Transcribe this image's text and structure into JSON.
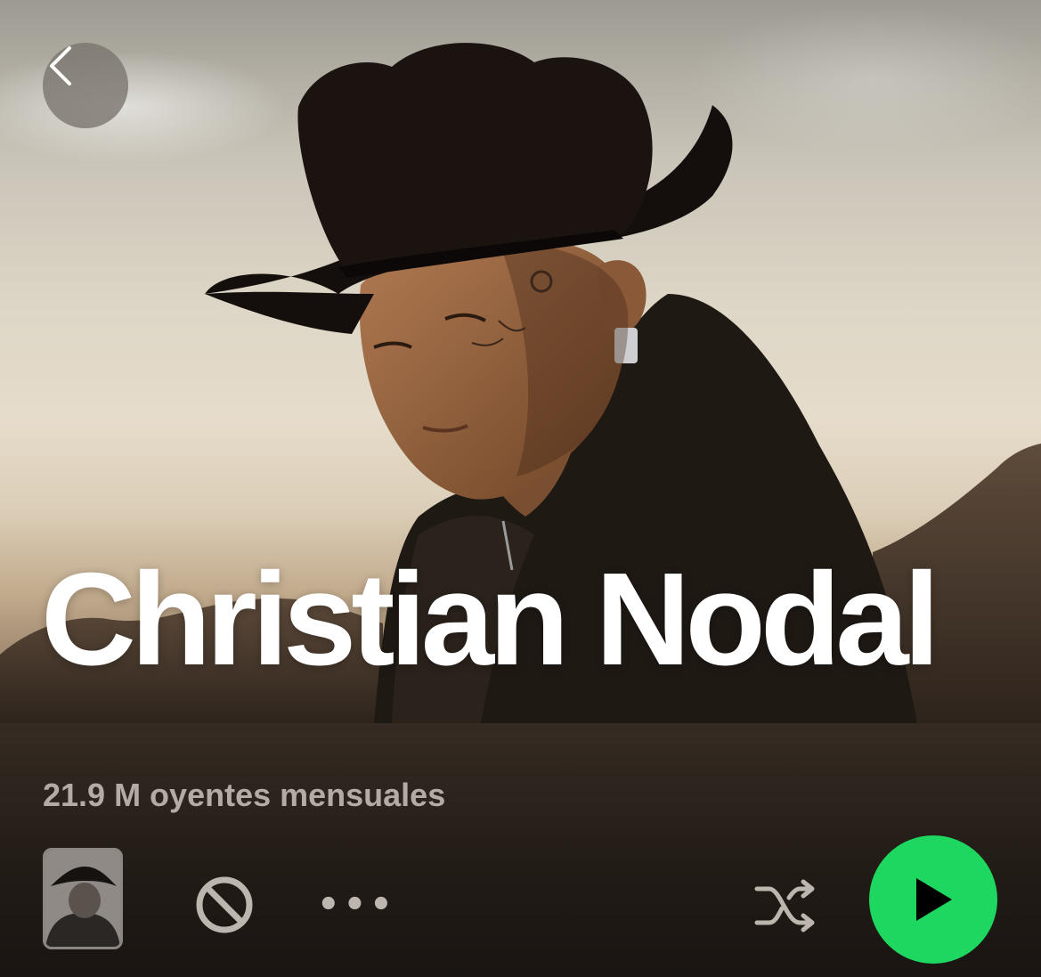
{
  "artist": {
    "name": "Christian Nodal",
    "monthly_listeners": "21.9 M oyentes mensuales"
  },
  "icons": {
    "back": "chevron-left-icon",
    "block": "block-icon",
    "more": "more-dots-icon",
    "shuffle": "shuffle-icon",
    "play": "play-icon"
  },
  "controls": {
    "more_label": "•••"
  },
  "colors": {
    "play_button": "#1ed760",
    "background": "#1c1713",
    "listeners_text": "#b3aca4",
    "name_text": "#ffffff"
  }
}
